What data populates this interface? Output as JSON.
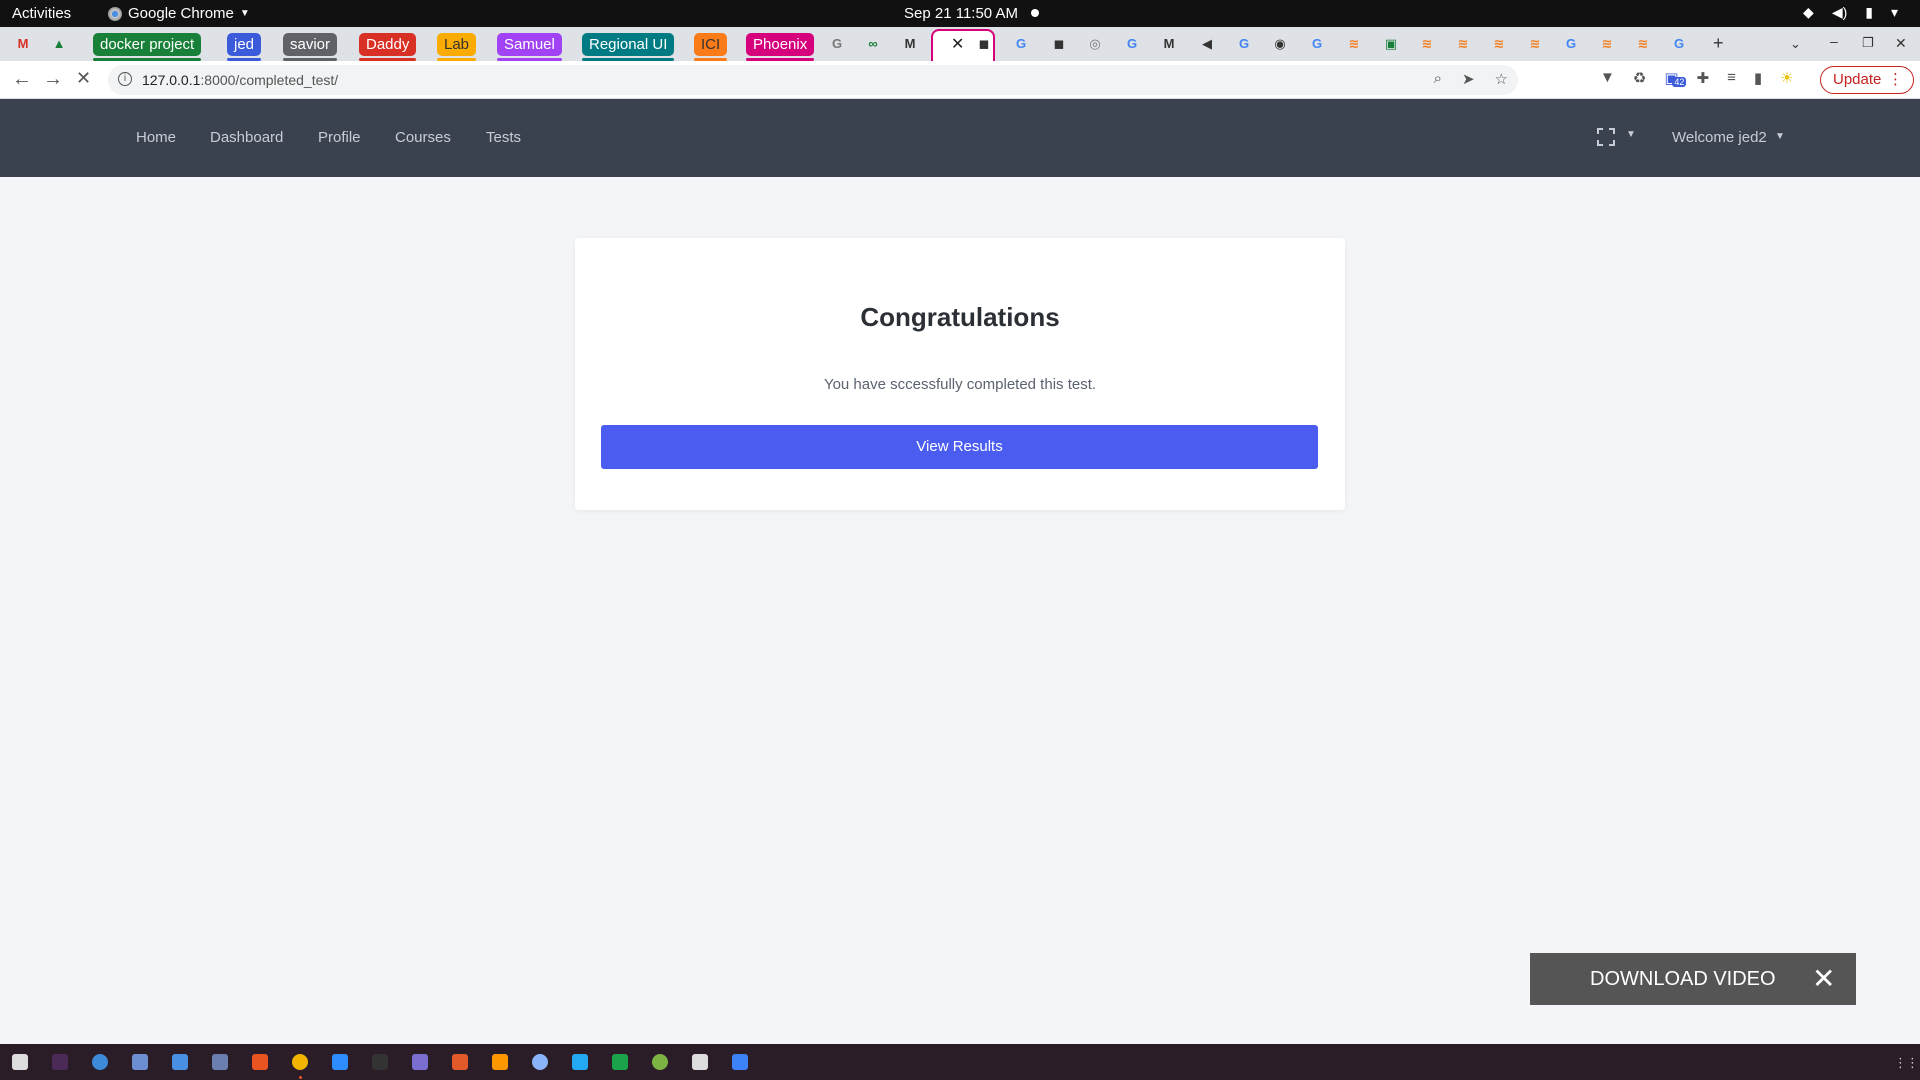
{
  "system_bar": {
    "activities": "Activities",
    "app_name": "Google Chrome",
    "datetime": "Sep 21  11:50 AM"
  },
  "tabs": {
    "groups": [
      {
        "label": "docker project",
        "color": "#188038"
      },
      {
        "label": "jed",
        "color": "#3b5bdb"
      },
      {
        "label": "savior",
        "color": "#5f6368"
      },
      {
        "label": "Daddy",
        "color": "#d93025"
      },
      {
        "label": "Lab",
        "color": "#f9ab00"
      },
      {
        "label": "Samuel",
        "color": "#a142f4"
      },
      {
        "label": "Regional UI",
        "color": "#007b83"
      },
      {
        "label": "ICI",
        "color": "#fa7b17"
      },
      {
        "label": "Phoenix",
        "color": "#d6007c"
      }
    ],
    "new_tab": "+"
  },
  "omnibox": {
    "url_host": "127.0.0.1",
    "url_rest": ":8000/completed_test/",
    "update_label": "Update",
    "extension_badge": "42"
  },
  "navbar": {
    "links": [
      "Home",
      "Dashboard",
      "Profile",
      "Courses",
      "Tests"
    ],
    "welcome": "Welcome jed2"
  },
  "card": {
    "title": "Congratulations",
    "message": "You have sccessfully completed this test.",
    "button_label": "View Results",
    "button_color": "#4b5cf0"
  },
  "overlay": {
    "download_label": "DOWNLOAD VIDEO"
  },
  "colors": {
    "navbar_bg": "#3a4250",
    "page_bg": "#f4f5f9",
    "accent": "#4b5cf0"
  }
}
